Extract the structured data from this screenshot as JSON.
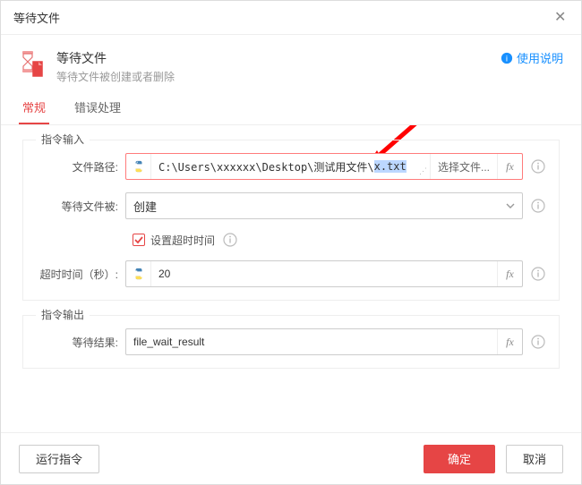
{
  "titlebar": {
    "title": "等待文件"
  },
  "header": {
    "title": "等待文件",
    "subtitle": "等待文件被创建或者删除",
    "help_label": "使用说明"
  },
  "tabs": {
    "general": "常规",
    "error": "错误处理"
  },
  "group_input": {
    "legend": "指令输入"
  },
  "group_output": {
    "legend": "指令输出"
  },
  "fields": {
    "file_path": {
      "label": "文件路径:",
      "value_prefix": "C:\\Users\\xxxxxx\\Desktop\\测试用文件\\",
      "value_highlight": "x.txt",
      "select_file_btn": "选择文件...",
      "fx": "fx"
    },
    "wait_file": {
      "label": "等待文件被:",
      "value": "创建"
    },
    "set_timeout": {
      "label": "设置超时时间",
      "checked": true
    },
    "timeout_sec": {
      "label": "超时时间（秒）:",
      "value": "20",
      "fx": "fx"
    },
    "result": {
      "label": "等待结果:",
      "value": "file_wait_result",
      "fx": "fx"
    }
  },
  "footer": {
    "run": "运行指令",
    "ok": "确定",
    "cancel": "取消"
  }
}
